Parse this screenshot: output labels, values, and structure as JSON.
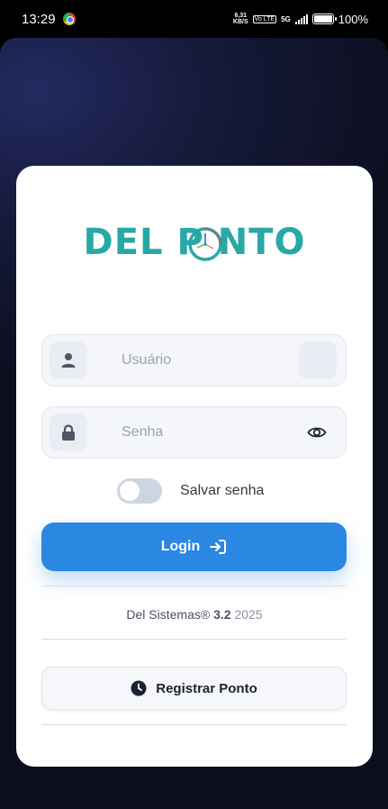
{
  "status_bar": {
    "time": "13:29",
    "net_speed_value": "6,31",
    "net_speed_unit": "KB/S",
    "volte": "Vo LTE",
    "network": "5G",
    "battery": "100%"
  },
  "logo": {
    "text": "DEL P NTO",
    "color": "#2aa7a7"
  },
  "form": {
    "username_placeholder": "Usuário",
    "password_placeholder": "Senha",
    "save_password_label": "Salvar senha",
    "save_password_on": false,
    "login_label": "Login"
  },
  "footer": {
    "company": "Del Sistemas®",
    "version": "3.2",
    "year": "2025"
  },
  "register_button_label": "Registrar Ponto",
  "colors": {
    "accent": "#2a87e2",
    "brand": "#2aa7a7",
    "background": "#0c0e1f"
  }
}
